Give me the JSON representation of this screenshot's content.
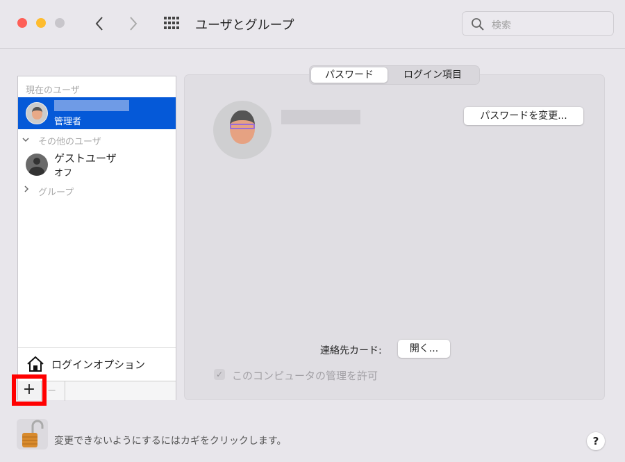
{
  "window": {
    "title": "ユーザとグループ",
    "search_placeholder": "検索"
  },
  "sidebar": {
    "current_header": "現在のユーザ",
    "current_user": {
      "role": "管理者"
    },
    "others_header": "その他のユーザ",
    "guest": {
      "name": "ゲストユーザ",
      "status": "オフ"
    },
    "groups_header": "グループ",
    "login_options": "ログインオプション",
    "add": "+",
    "remove": "−"
  },
  "tabs": [
    {
      "label": "パスワード",
      "selected": true
    },
    {
      "label": "ログイン項目",
      "selected": false
    }
  ],
  "main": {
    "change_password": "パスワードを変更...",
    "contact_label": "連絡先カード:",
    "open_button": "開く...",
    "allow_admin": "このコンピュータの管理を許可",
    "allow_admin_checked": true
  },
  "footer": {
    "lock_text": "変更できないようにするにはカギをクリックします。",
    "help": "?"
  },
  "colors": {
    "accent": "#0559d8",
    "highlight": "#ff0000"
  }
}
